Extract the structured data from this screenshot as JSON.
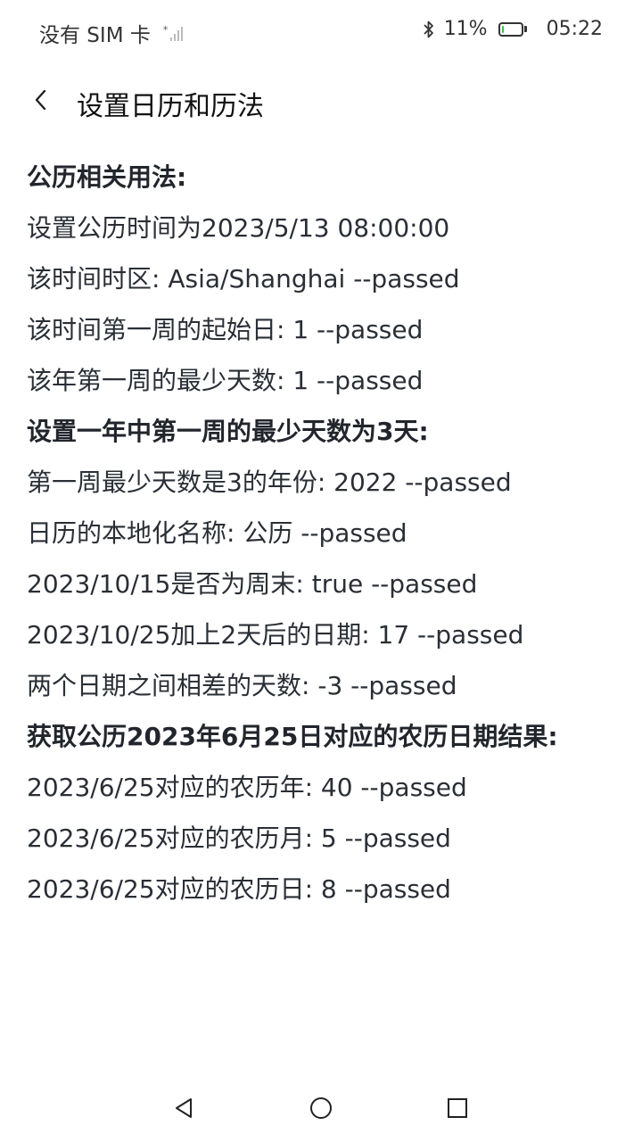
{
  "status_bar": {
    "carrier": "没有 SIM 卡",
    "battery_percent": "11%",
    "battery_level": 0.11,
    "time": "05:22"
  },
  "header": {
    "title": "设置日历和历法"
  },
  "lines": [
    {
      "text": "公历相关用法:",
      "type": "heading"
    },
    {
      "text": "设置公历时间为2023/5/13 08:00:00",
      "type": "text"
    },
    {
      "text": "该时间时区: Asia/Shanghai --passed",
      "type": "text"
    },
    {
      "text": "该时间第一周的起始日: 1 --passed",
      "type": "text"
    },
    {
      "text": "该年第一周的最少天数: 1 --passed",
      "type": "text"
    },
    {
      "text": "设置一年中第一周的最少天数为3天:",
      "type": "heading"
    },
    {
      "text": "第一周最少天数是3的年份: 2022 --passed",
      "type": "text"
    },
    {
      "text": "日历的本地化名称: 公历 --passed",
      "type": "text"
    },
    {
      "text": "2023/10/15是否为周末: true --passed",
      "type": "text"
    },
    {
      "text": "2023/10/25加上2天后的日期: 17 --passed",
      "type": "text"
    },
    {
      "text": "两个日期之间相差的天数: -3 --passed",
      "type": "text"
    },
    {
      "text": "获取公历2023年6月25日对应的农历日期结果:",
      "type": "heading"
    },
    {
      "text": "2023/6/25对应的农历年: 40 --passed",
      "type": "text"
    },
    {
      "text": "2023/6/25对应的农历月: 5 --passed",
      "type": "text"
    },
    {
      "text": "2023/6/25对应的农历日: 8 --passed",
      "type": "text"
    }
  ],
  "icons": {
    "back": "chevron-left-icon",
    "bluetooth": "bluetooth-icon",
    "battery": "battery-icon",
    "signal": "signal-icon",
    "nav_back": "triangle-back-icon",
    "nav_home": "circle-home-icon",
    "nav_recent": "square-recent-icon"
  },
  "colors": {
    "battery_fill": "#3cbf4a",
    "text": "#2a2f36"
  }
}
